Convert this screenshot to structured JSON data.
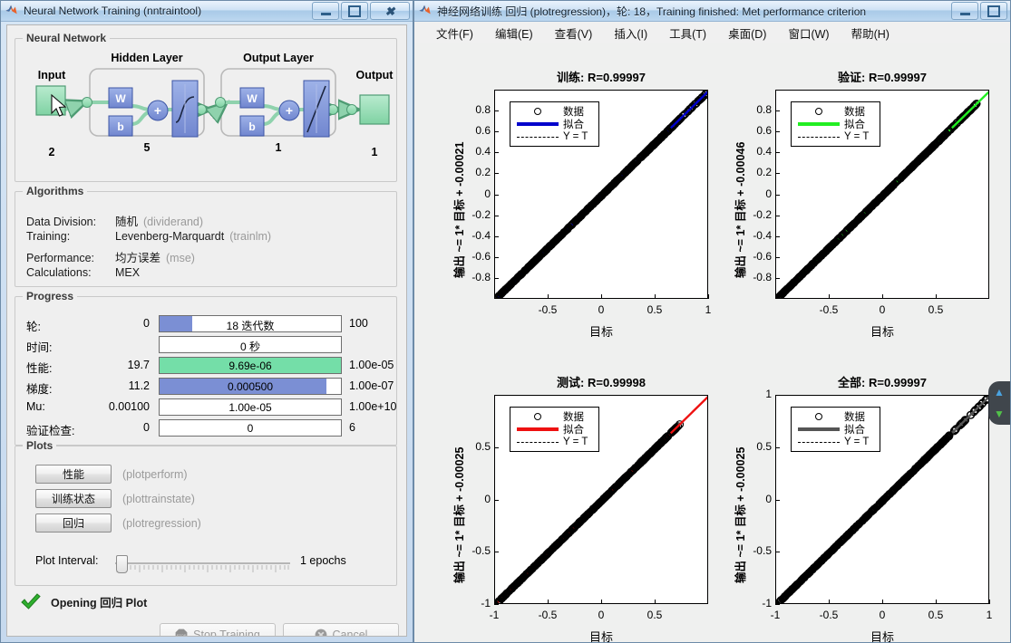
{
  "nntrain": {
    "window_title": "Neural Network Training (nntraintool)",
    "window_buttons": {
      "minimize": "minimize-icon",
      "maximize": "maximize-icon",
      "close": "close-icon"
    },
    "neural_network": {
      "group_title": "Neural Network",
      "input_label": "Input",
      "input_count": "2",
      "hidden_layer_label": "Hidden Layer",
      "hidden_count": "5",
      "output_layer_label": "Output Layer",
      "output_layer_count": "1",
      "output_label": "Output",
      "output_count": "1",
      "weight_symbol": "W",
      "bias_symbol": "b",
      "sum_symbol": "+"
    },
    "algorithms": {
      "group_title": "Algorithms",
      "rows": [
        {
          "label": "Data Division:",
          "value": "随机",
          "fn": "(dividerand)"
        },
        {
          "label": "Training:",
          "value": "Levenberg-Marquardt",
          "fn": "(trainlm)"
        },
        {
          "label": "Performance:",
          "value": "均方误差",
          "fn": "(mse)"
        },
        {
          "label": "Calculations:",
          "value": "MEX",
          "fn": ""
        }
      ]
    },
    "progress": {
      "group_title": "Progress",
      "rows": [
        {
          "name": "轮:",
          "left": "0",
          "bar_text": "18 迭代数",
          "right": "100",
          "fill_pct": 18,
          "fill_color": "#7b8fd4"
        },
        {
          "name": "时间:",
          "left": "",
          "bar_text": "0 秒",
          "right": "",
          "fill_pct": 0,
          "fill_color": "#7b8fd4"
        },
        {
          "name": "性能:",
          "left": "19.7",
          "bar_text": "9.69e-06",
          "right": "1.00e-05",
          "fill_pct": 100,
          "fill_color": "#74dea8"
        },
        {
          "name": "梯度:",
          "left": "11.2",
          "bar_text": "0.000500",
          "right": "1.00e-07",
          "fill_pct": 92,
          "fill_color": "#7b8fd4"
        },
        {
          "name": "Mu:",
          "left": "0.00100",
          "bar_text": "1.00e-05",
          "right": "1.00e+10",
          "fill_pct": 0,
          "fill_color": "#7b8fd4"
        },
        {
          "name": "验证检查:",
          "left": "0",
          "bar_text": "0",
          "right": "6",
          "fill_pct": 0,
          "fill_color": "#7b8fd4"
        }
      ]
    },
    "plots": {
      "group_title": "Plots",
      "buttons": [
        {
          "label": "性能",
          "fn": "(plotperform)"
        },
        {
          "label": "训练状态",
          "fn": "(plottrainstate)"
        },
        {
          "label": "回归",
          "fn": "(plotregression)"
        }
      ],
      "interval_label": "Plot Interval:",
      "interval_value": "1 epochs"
    },
    "status": {
      "icon": "green-check-icon",
      "text": "Opening 回归 Plot"
    },
    "footer_buttons": [
      {
        "label": "Stop Training",
        "icon": "stop-sign-icon"
      },
      {
        "label": "Cancel",
        "icon": "cancel-icon"
      }
    ]
  },
  "plotfig": {
    "window_title": "神经网络训练 回归 (plotregression)，轮: 18，Training finished: Met performance criterion",
    "menus": [
      "文件(F)",
      "编辑(E)",
      "查看(V)",
      "插入(I)",
      "工具(T)",
      "桌面(D)",
      "窗口(W)",
      "帮助(H)"
    ],
    "scroll_nav": {
      "up": "scroll-up-arrow-icon",
      "down": "scroll-down-arrow-icon"
    }
  },
  "chart_data": [
    {
      "type": "scatter",
      "id": "train",
      "title": "训练: R=0.99997",
      "title_prefix": "训练: ",
      "title_r": "R=0.99997",
      "r_value": 0.99997,
      "xlabel": "目标",
      "ylabel": "输出 ~= 1* 目标 + -0.00021",
      "fit_slope": 1,
      "fit_intercept": -0.00021,
      "xlim": [
        -1,
        1
      ],
      "ylim": [
        -1,
        1
      ],
      "xticks": [
        -0.5,
        0,
        0.5,
        1
      ],
      "xticklabels": [
        "-0.5",
        "0",
        "0.5",
        "1"
      ],
      "yticks": [
        -0.8,
        -0.6,
        -0.4,
        -0.2,
        0,
        0.2,
        0.4,
        0.6,
        0.8
      ],
      "yticklabels": [
        "-0.8",
        "-0.6",
        "-0.4",
        "-0.2",
        "0",
        "0.2",
        "0.4",
        "0.6",
        "0.8"
      ],
      "grid": false,
      "fit_color": "#0000cc",
      "marker_color": "#000000",
      "legend_position": "upper-left",
      "legend": [
        {
          "key": "circle",
          "label": "数据"
        },
        {
          "key": "line",
          "label": "拟合"
        },
        {
          "key": "dash",
          "label": "Y = T"
        }
      ],
      "note": "Dense band of ~thousands of points lying on the identity line from (-1,-1) to (1,1)"
    },
    {
      "type": "scatter",
      "id": "validation",
      "title": "验证: R=0.99997",
      "title_prefix": "验证: ",
      "title_r": "R=0.99997",
      "r_value": 0.99997,
      "xlabel": "目标",
      "ylabel": "输出 ~= 1* 目标 + -0.00046",
      "fit_slope": 1,
      "fit_intercept": -0.00046,
      "xlim": [
        -1,
        1
      ],
      "ylim": [
        -1,
        1
      ],
      "xticks": [
        -0.5,
        0,
        0.5
      ],
      "xticklabels": [
        "-0.5",
        "0",
        "0.5"
      ],
      "yticks": [
        -0.8,
        -0.6,
        -0.4,
        -0.2,
        0,
        0.2,
        0.4,
        0.6,
        0.8
      ],
      "yticklabels": [
        "-0.8",
        "-0.6",
        "-0.4",
        "-0.2",
        "0",
        "0.2",
        "0.4",
        "0.6",
        "0.8"
      ],
      "grid": false,
      "fit_color": "#22ee22",
      "marker_color": "#000000",
      "legend_position": "upper-left",
      "legend": [
        {
          "key": "circle",
          "label": "数据"
        },
        {
          "key": "line",
          "label": "拟合"
        },
        {
          "key": "dash",
          "label": "Y = T"
        }
      ],
      "note": "Dense band of points on identity line"
    },
    {
      "type": "scatter",
      "id": "test",
      "title": "测试: R=0.99998",
      "title_prefix": "测试: ",
      "title_r": "R=0.99998",
      "r_value": 0.99998,
      "xlabel": "目标",
      "ylabel": "输出 ~= 1* 目标 + -0.00025",
      "fit_slope": 1,
      "fit_intercept": -0.00025,
      "xlim": [
        -1,
        1
      ],
      "ylim": [
        -1,
        1
      ],
      "xticks": [
        -1,
        -0.5,
        0,
        0.5
      ],
      "xticklabels": [
        "-1",
        "-0.5",
        "0",
        "0.5"
      ],
      "yticks": [
        -1,
        -0.5,
        0,
        0.5
      ],
      "yticklabels": [
        "-1",
        "-0.5",
        "0",
        "0.5"
      ],
      "grid": false,
      "fit_color": "#ee1111",
      "marker_color": "#000000",
      "legend_position": "upper-left",
      "legend": [
        {
          "key": "circle",
          "label": "数据"
        },
        {
          "key": "line",
          "label": "拟合"
        },
        {
          "key": "dash",
          "label": "Y = T"
        }
      ],
      "note": "Dense band of points on identity line"
    },
    {
      "type": "scatter",
      "id": "all",
      "title": "全部: R=0.99997",
      "title_prefix": "全部: ",
      "title_r": "R=0.99997",
      "r_value": 0.99997,
      "xlabel": "目标",
      "ylabel": "输出 ~= 1* 目标 + -0.00025",
      "fit_slope": 1,
      "fit_intercept": -0.00025,
      "xlim": [
        -1,
        1
      ],
      "ylim": [
        -1,
        1
      ],
      "xticks": [
        -1,
        -0.5,
        0,
        0.5,
        1
      ],
      "xticklabels": [
        "-1",
        "-0.5",
        "0",
        "0.5",
        "1"
      ],
      "yticks": [
        -1,
        -0.5,
        0,
        0.5,
        1
      ],
      "yticklabels": [
        "-1",
        "-0.5",
        "0",
        "0.5",
        "1"
      ],
      "grid": false,
      "fit_color": "#555555",
      "marker_color": "#000000",
      "legend_position": "upper-left",
      "legend": [
        {
          "key": "circle",
          "label": "数据"
        },
        {
          "key": "line",
          "label": "拟合"
        },
        {
          "key": "dash",
          "label": "Y = T"
        }
      ],
      "note": "Dense band of points on identity line"
    }
  ]
}
